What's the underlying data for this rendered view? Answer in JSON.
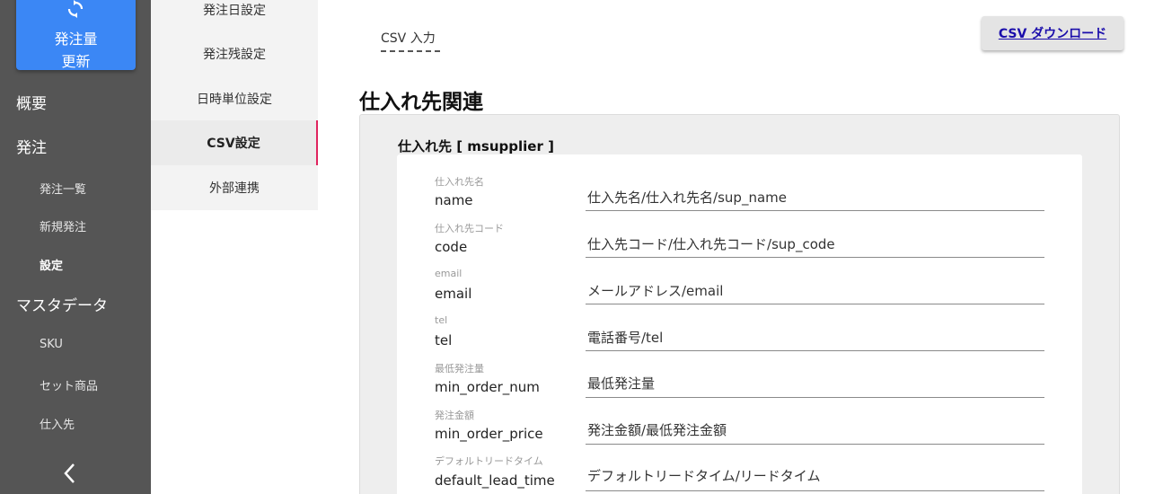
{
  "sidebar": {
    "refresh_button": {
      "line1": "発注量",
      "line2": "更新",
      "icon": "refresh-icon"
    },
    "overview": "概要",
    "order": "発注",
    "order_list": "発注一覧",
    "new_order": "新規発注",
    "settings": "設定",
    "master_data": "マスタデータ",
    "sku": "SKU",
    "set_product": "セット商品",
    "supplier": "仕入先",
    "collapse_icon": "chevron-left-icon"
  },
  "submenu": {
    "items": [
      {
        "label": "発注日設定"
      },
      {
        "label": "発注残設定"
      },
      {
        "label": "日時単位設定"
      },
      {
        "label": "CSV設定"
      },
      {
        "label": "外部連携"
      }
    ],
    "active_index": 3,
    "active_color": "#e0245e"
  },
  "main": {
    "tab_csv_input": "CSV 入力",
    "download_button": "CSV ダウンロード",
    "section_title": "仕入れ先関連",
    "panel_title": "仕入れ先 [ msupplier ]",
    "rows": [
      {
        "label_small": "仕入れ先名",
        "label": "name",
        "value": "仕入先名/仕入れ先名/sup_name"
      },
      {
        "label_small": "仕入れ先コード",
        "label": "code",
        "value": "仕入先コード/仕入れ先コード/sup_code"
      },
      {
        "label_small": "email",
        "label": "email",
        "value": "メールアドレス/email"
      },
      {
        "label_small": "tel",
        "label": "tel",
        "value": "電話番号/tel"
      },
      {
        "label_small": "最低発注量",
        "label": "min_order_num",
        "value": "最低発注量"
      },
      {
        "label_small": "発注金額",
        "label": "min_order_price",
        "value": "発注金額/最低発注金額"
      },
      {
        "label_small": "デフォルトリードタイム",
        "label": "default_lead_time",
        "value": "デフォルトリードタイム/リードタイム"
      }
    ]
  },
  "colors": {
    "sidebar_bg": "#555555",
    "refresh_button_bg": "#3b87f5",
    "link_color": "#1a0dab"
  }
}
